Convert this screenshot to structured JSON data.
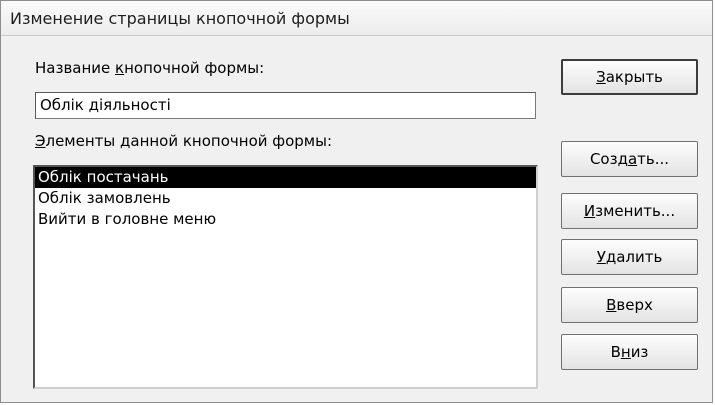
{
  "dialog": {
    "title": "Изменение страницы кнопочной формы"
  },
  "form_name": {
    "label_pre": "Название ",
    "label_key": "к",
    "label_post": "нопочной формы:",
    "value": "Облік діяльності"
  },
  "items_section": {
    "label_key": "Э",
    "label_post": "лементы данной кнопочной формы:",
    "items": [
      {
        "label": "Облік постачань",
        "selected": true
      },
      {
        "label": "Облік замовлень",
        "selected": false
      },
      {
        "label": "Вийти в головне меню",
        "selected": false
      }
    ]
  },
  "buttons": {
    "close": {
      "pre": "",
      "key": "З",
      "post": "акрыть"
    },
    "create": {
      "pre": "Созд",
      "key": "а",
      "post": "ть..."
    },
    "edit": {
      "pre": "",
      "key": "И",
      "post": "зменить..."
    },
    "delete": {
      "pre": "",
      "key": "У",
      "post": "далить"
    },
    "up": {
      "pre": "",
      "key": "В",
      "post": "верх"
    },
    "down": {
      "pre": "В",
      "key": "н",
      "post": "из"
    }
  }
}
